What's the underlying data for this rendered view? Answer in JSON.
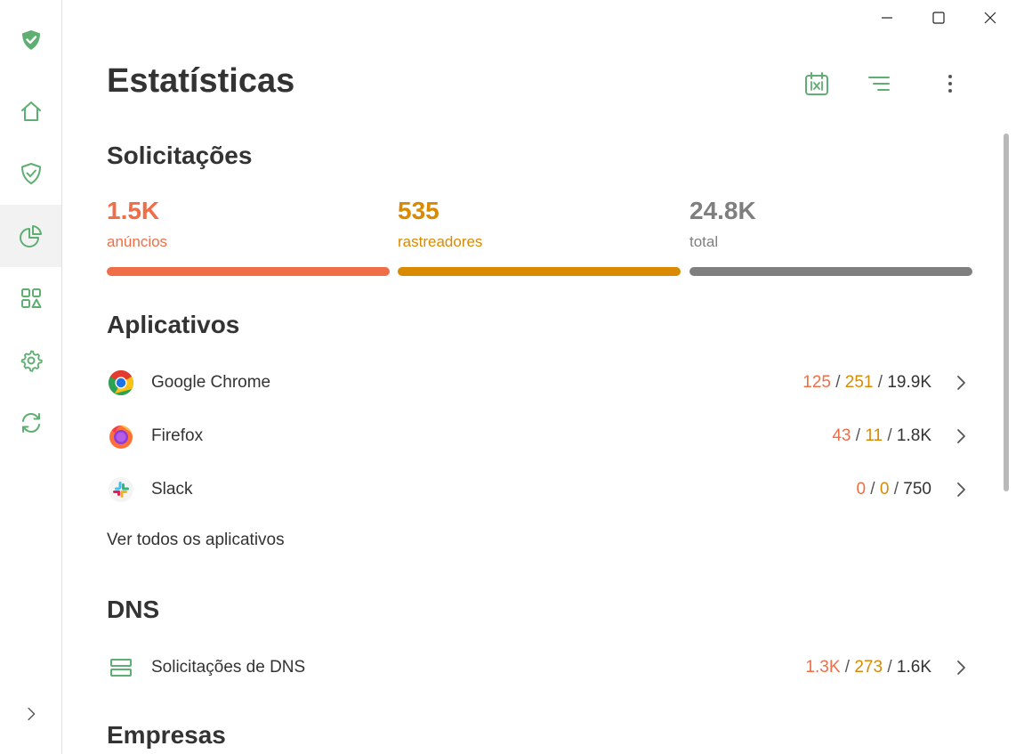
{
  "app": {
    "title": "Estatísticas",
    "colors": {
      "accent": "#67b279",
      "ads": "#ef6e48",
      "trackers": "#d98a00",
      "total": "#7f7f7f",
      "icon_green": "#5fae72"
    }
  },
  "sidebar": {
    "items": [
      {
        "name": "logo",
        "icon": "adguard-shield-icon"
      },
      {
        "name": "home",
        "icon": "home-icon"
      },
      {
        "name": "protection",
        "icon": "shield-check-icon"
      },
      {
        "name": "statistics",
        "icon": "pie-chart-icon",
        "active": true
      },
      {
        "name": "apps",
        "icon": "apps-grid-icon"
      },
      {
        "name": "settings",
        "icon": "gear-icon"
      },
      {
        "name": "updates",
        "icon": "refresh-icon"
      },
      {
        "name": "expand",
        "icon": "chevron-right-icon"
      }
    ]
  },
  "window_controls": [
    "minimize-icon",
    "maximize-icon",
    "close-icon"
  ],
  "toolbar": [
    "calendar-icon",
    "filter-icon",
    "more-vert-icon"
  ],
  "requests": {
    "section_title": "Solicitações",
    "stats": [
      {
        "value": "1.5K",
        "label": "anúncios",
        "color": "#ef6e48"
      },
      {
        "value": "535",
        "label": "rastreadores",
        "color": "#d98a00"
      },
      {
        "value": "24.8K",
        "label": "total",
        "color": "#7f7f7f"
      }
    ]
  },
  "apps": {
    "section_title": "Aplicativos",
    "rows": [
      {
        "name": "Google Chrome",
        "icon": "chrome-icon",
        "ads": "125",
        "trackers": "251",
        "total": "19.9K"
      },
      {
        "name": "Firefox",
        "icon": "firefox-icon",
        "ads": "43",
        "trackers": "11",
        "total": "1.8K"
      },
      {
        "name": "Slack",
        "icon": "slack-icon",
        "ads": "0",
        "trackers": "0",
        "total": "750"
      }
    ],
    "see_all": "Ver todos os aplicativos"
  },
  "dns": {
    "section_title": "DNS",
    "rows": [
      {
        "name": "Solicitações de DNS",
        "icon": "dns-servers-icon",
        "ads": "1.3K",
        "trackers": "273",
        "total": "1.6K"
      }
    ]
  },
  "companies": {
    "section_title": "Empresas"
  },
  "separator": " / "
}
